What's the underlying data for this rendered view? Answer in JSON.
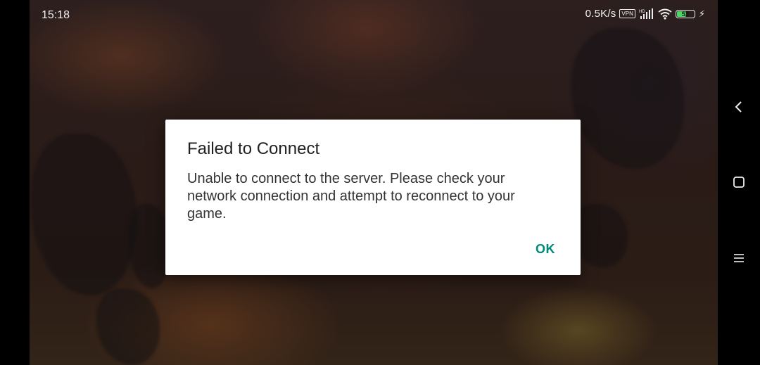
{
  "status_bar": {
    "time": "15:18",
    "net_speed": "0.5K/s",
    "vpn_label": "VPN",
    "signal_label": "HD",
    "battery_level": "53",
    "icons": [
      "vpn-icon",
      "signal-icon",
      "wifi-icon",
      "battery-icon",
      "charging-icon"
    ]
  },
  "nav_bar": {
    "icons": [
      "back-icon",
      "home-icon",
      "recents-icon"
    ]
  },
  "dialog": {
    "title": "Failed to Connect",
    "message": "Unable to connect to the server. Please check your network connection and attempt to reconnect to your game.",
    "ok_label": "OK",
    "accent_color": "#00897b"
  }
}
